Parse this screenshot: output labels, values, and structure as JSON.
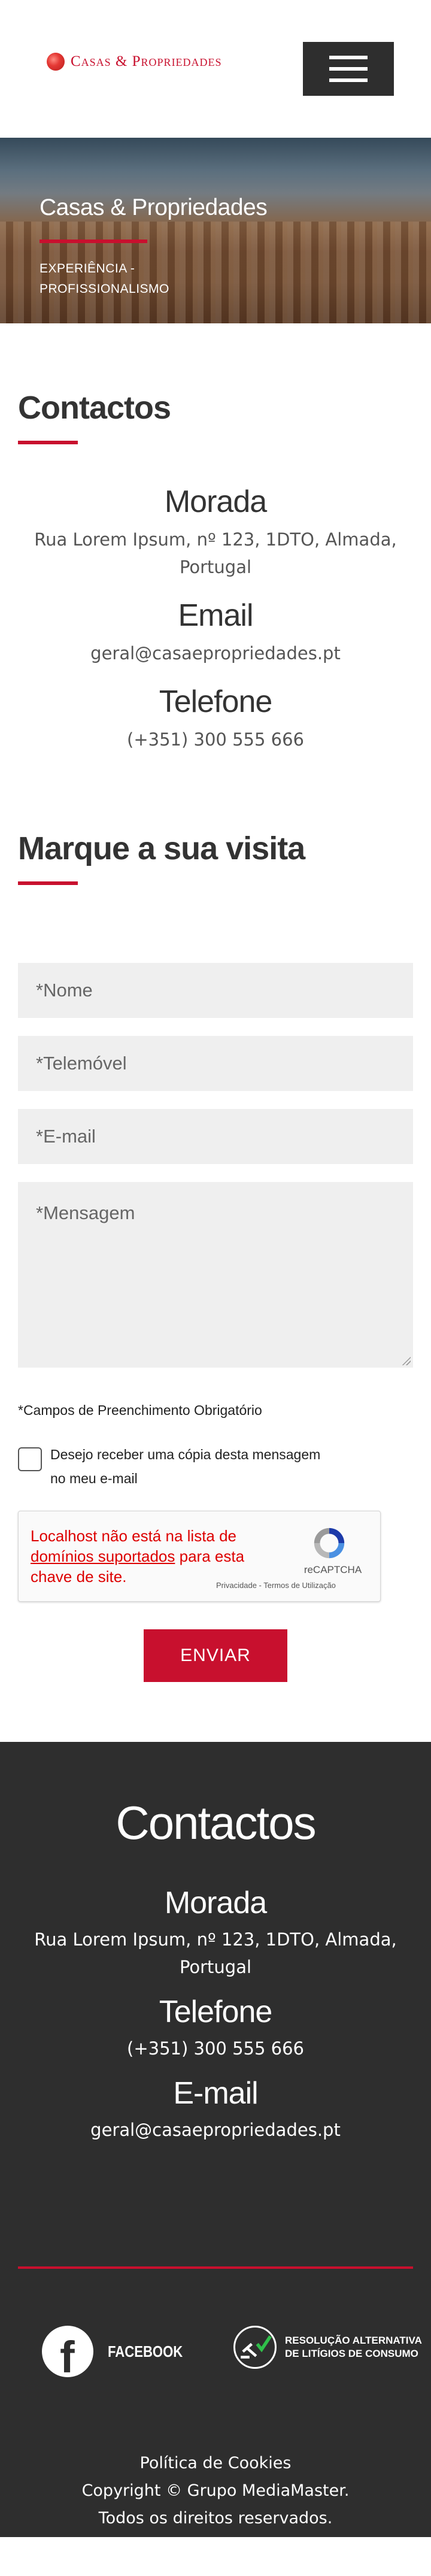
{
  "header": {
    "logo_text": "Casas & Propriedades",
    "menu_icon": "hamburger-menu-icon"
  },
  "hero": {
    "title": "Casas & Propriedades",
    "subtitle_line1": "EXPERIÊNCIA -",
    "subtitle_line2": "PROFISSIONALISMO"
  },
  "contacts": {
    "title": "Contactos",
    "address_label": "Morada",
    "address_line1": "Rua Lorem Ipsum, nº 123, 1DTO, Almada,",
    "address_line2": "Portugal",
    "email_label": "Email",
    "email": "geral@casaepropriedades.pt",
    "phone_label": "Telefone",
    "phone": "(+351) 300 555 666"
  },
  "visit": {
    "title": "Marque a sua visita",
    "name_placeholder": "*Nome",
    "mobile_placeholder": "*Telemóvel",
    "email_placeholder": "*E-mail",
    "message_placeholder": "*Mensagem",
    "required_note": "*Campos de Preenchimento Obrigatório",
    "copy_line1": "Desejo receber uma cópia desta mensagem",
    "copy_line2": "no meu e-mail",
    "captcha_error_a": "Localhost não está na lista de",
    "captcha_error_link": "domínios suportados",
    "captcha_error_b": "para",
    "captcha_error_c": "esta chave de site.",
    "captcha_brand": "reCAPTCHA",
    "captcha_links": "Privacidade - Termos de Utilização",
    "send_label": "ENVIAR"
  },
  "footer": {
    "title": "Contactos",
    "address_label": "Morada",
    "address_line1": "Rua Lorem Ipsum, nº 123, 1DTO, Almada,",
    "address_line2": "Portugal",
    "phone_label": "Telefone",
    "phone": "(+351) 300 555 666",
    "email_label": "E-mail",
    "email": "geral@casaepropriedades.pt",
    "facebook_label": "FACEBOOK",
    "ral_line1": "RESOLUÇÃO ALTERNATIVA",
    "ral_line2": "DE LITÍGIOS DE CONSUMO",
    "cookies": "Política de Cookies",
    "copyright": "Copyright © Grupo MediaMaster.",
    "rights": "Todos os direitos reservados."
  },
  "colors": {
    "accent": "#c8102e",
    "dark": "#2e2e2e",
    "field_bg": "#efefef"
  }
}
